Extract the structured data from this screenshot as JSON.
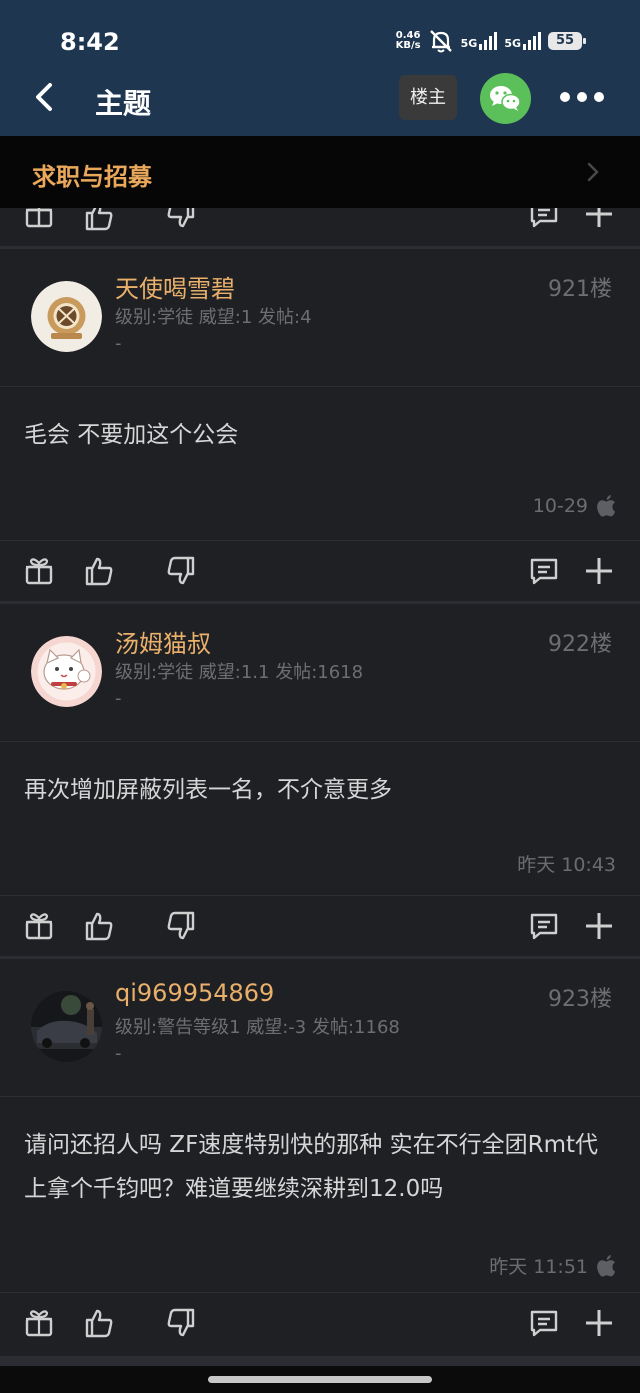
{
  "status": {
    "time": "8:42",
    "net_speed_value": "0.46",
    "net_speed_unit": "KB/s",
    "signal1": "5G",
    "signal2": "5G",
    "battery": "55"
  },
  "nav": {
    "title": "主题",
    "op_button": "楼主",
    "wechat_icon": "wechat-icon",
    "more_icon": "more-icon"
  },
  "category": {
    "label": "求职与招募"
  },
  "posts": [
    {
      "username": "天使喝雪碧",
      "info": "级别:学徒  威望:1  发帖:4",
      "dash": "-",
      "floor": "921楼",
      "content": "毛会 不要加这个公会",
      "date": "10-29",
      "device_icon": "apple-icon"
    },
    {
      "username": "汤姆猫叔",
      "info": "级别:学徒  威望:1.1  发帖:1618",
      "dash": "-",
      "floor": "922楼",
      "content": "再次增加屏蔽列表一名，不介意更多",
      "date": "昨天 10:43",
      "device_icon": ""
    },
    {
      "username": "qi969954869",
      "info": "级别:警告等级1  威望:-3  发帖:1168",
      "dash": "-",
      "floor": "923楼",
      "content": "请问还招人吗 ZF速度特别快的那种 实在不行全团Rmt代上拿个千钧吧？难道要继续深耕到12.0吗",
      "date": "昨天 11:51",
      "device_icon": "apple-icon"
    }
  ],
  "colors": {
    "header_bg": "#1f3650",
    "accent": "#e9a85c",
    "wechat": "#5cc05a",
    "card_bg": "#1f2024"
  }
}
